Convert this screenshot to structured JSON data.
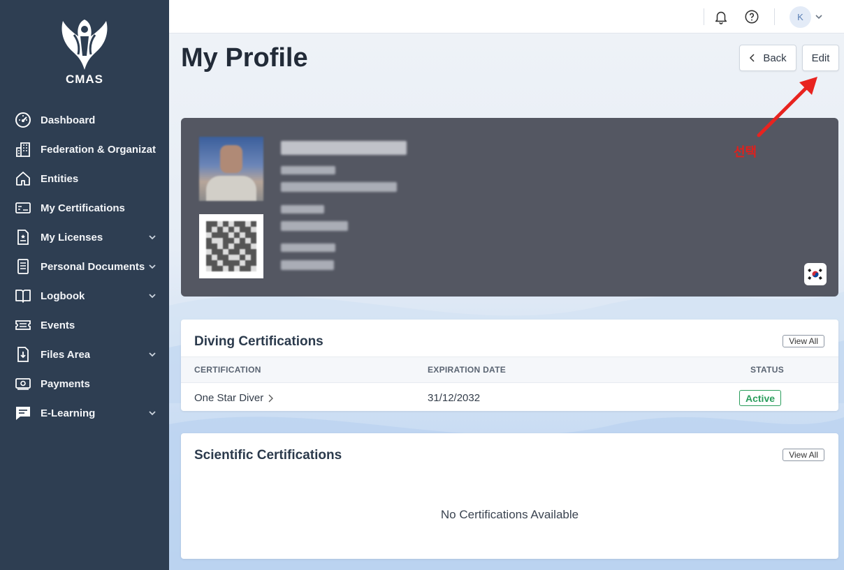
{
  "brand": {
    "logo_text": "CMAS"
  },
  "sidebar": {
    "items": [
      {
        "label": "Dashboard",
        "icon": "gauge-icon",
        "expandable": false
      },
      {
        "label": "Federation & Organizatio",
        "icon": "building-icon",
        "expandable": false
      },
      {
        "label": "Entities",
        "icon": "home-icon",
        "expandable": false
      },
      {
        "label": "My Certifications",
        "icon": "certificate-card-icon",
        "expandable": false
      },
      {
        "label": "My Licenses",
        "icon": "license-doc-icon",
        "expandable": true
      },
      {
        "label": "Personal Documents",
        "icon": "document-icon",
        "expandable": true
      },
      {
        "label": "Logbook",
        "icon": "book-icon",
        "expandable": true
      },
      {
        "label": "Events",
        "icon": "ticket-icon",
        "expandable": false
      },
      {
        "label": "Files Area",
        "icon": "file-download-icon",
        "expandable": true
      },
      {
        "label": "Payments",
        "icon": "money-icon",
        "expandable": false
      },
      {
        "label": "E-Learning",
        "icon": "chat-icon",
        "expandable": true
      }
    ]
  },
  "topbar": {
    "avatar_initial": "K"
  },
  "page": {
    "title": "My Profile",
    "back_label": "Back",
    "edit_label": "Edit"
  },
  "profile": {
    "flag": "korea-flag-icon"
  },
  "diving": {
    "title": "Diving Certifications",
    "view_all": "View All",
    "columns": [
      "CERTIFICATION",
      "EXPIRATION DATE",
      "STATUS"
    ],
    "rows": [
      {
        "certification": "One Star Diver",
        "expiration": "31/12/2032",
        "status": "Active"
      }
    ]
  },
  "scientific": {
    "title": "Scientific Certifications",
    "view_all": "View All",
    "empty_text": "No Certifications Available"
  },
  "annotation": {
    "text": "선택",
    "color": "#e0201c"
  }
}
